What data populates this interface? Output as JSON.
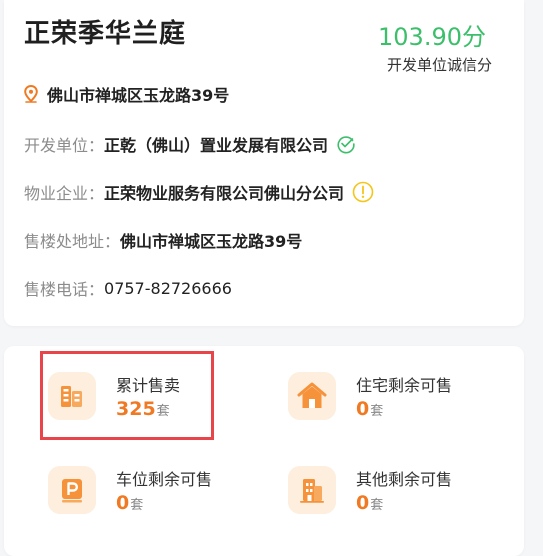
{
  "project": {
    "name": "正荣季华兰庭",
    "score": "103.90分",
    "score_label": "开发单位诚信分",
    "address": "佛山市禅城区玉龙路39号"
  },
  "details": [
    {
      "label": "开发单位：",
      "value": "正乾（佛山）置业发展有限公司",
      "status_icon": "check-circle-icon",
      "status_color": "#3cbf6b"
    },
    {
      "label": "物业企业：",
      "value": "正荣物业服务有限公司佛山分公司",
      "status_icon": "warning-circle-icon",
      "status_color": "#f5c518"
    },
    {
      "label": "售楼处地址：",
      "value": "佛山市禅城区玉龙路39号"
    },
    {
      "label": "售楼电话：",
      "value": "0757-82726666"
    }
  ],
  "stats": [
    {
      "title": "累计售卖",
      "value": "325",
      "unit": "套",
      "icon": "building-icon",
      "highlighted": true
    },
    {
      "title": "住宅剩余可售",
      "value": "0",
      "unit": "套",
      "icon": "house-icon"
    },
    {
      "title": "车位剩余可售",
      "value": "0",
      "unit": "套",
      "icon": "parking-icon"
    },
    {
      "title": "其他剩余可售",
      "value": "0",
      "unit": "套",
      "icon": "office-icon"
    }
  ],
  "colors": {
    "score_green": "#3cbf6b",
    "accent_orange": "#f07a24",
    "icon_bg": "#fdeedd",
    "highlight_red": "#e8454b"
  }
}
